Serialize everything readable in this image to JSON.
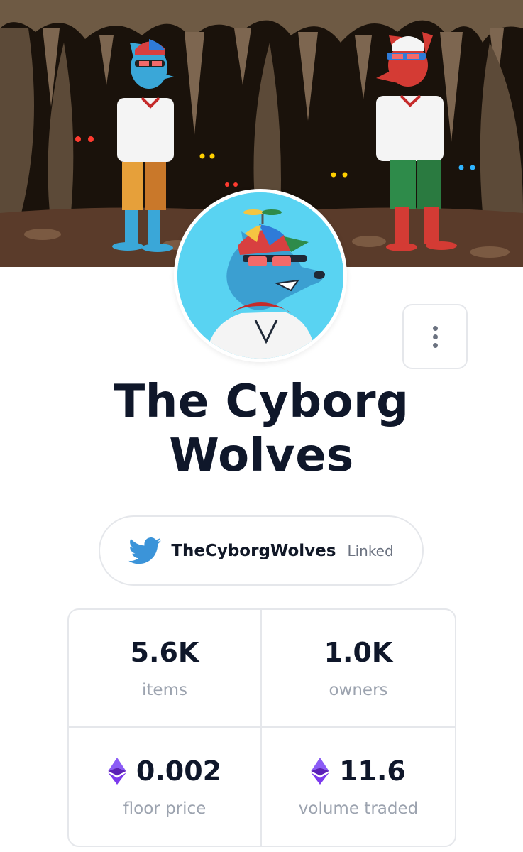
{
  "collection": {
    "name": "The Cyborg Wolves"
  },
  "banner": {
    "icon": "cave-wolves-illustration"
  },
  "avatar": {
    "icon": "blue-wolf-propeller-cap-avatar"
  },
  "more_button": {
    "icon": "vertical-ellipsis-icon"
  },
  "twitter": {
    "icon": "twitter-bird-icon",
    "handle": "TheCyborgWolves",
    "status": "Linked",
    "color": "#3b94d9"
  },
  "stats": [
    {
      "value": "5.6K",
      "label": "items"
    },
    {
      "value": "1.0K",
      "label": "owners"
    },
    {
      "value": "0.002",
      "label": "floor price",
      "icon": "ethereum-icon"
    },
    {
      "value": "11.6",
      "label": "volume traded",
      "icon": "ethereum-icon"
    }
  ],
  "colors": {
    "ethereum": "#7b4fd6",
    "border": "#e5e7eb",
    "text_primary": "#0f172a",
    "text_muted": "#9ca3af"
  }
}
